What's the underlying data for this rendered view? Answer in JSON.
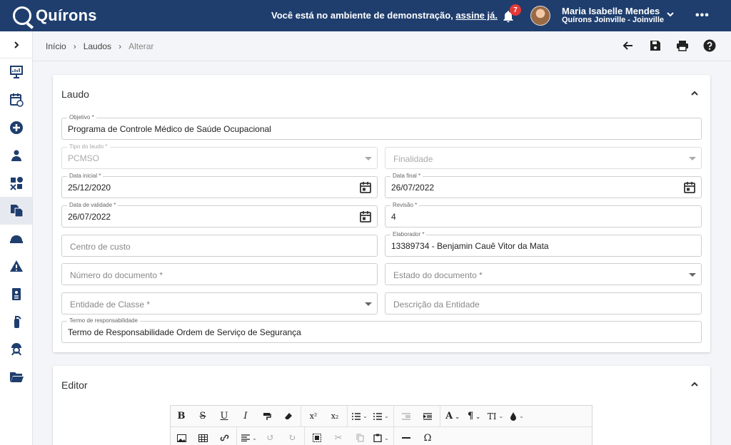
{
  "app": {
    "brand": "Quírons"
  },
  "header": {
    "demo_text": "Você está no ambiente de demonstração, ",
    "demo_link": "assine já.",
    "notifications": "7",
    "user_name": "Maria Isabelle Mendes",
    "user_org": "Quírons Joinville - Joinville"
  },
  "breadcrumb": {
    "home": "Início",
    "section": "Laudos",
    "current": "Alterar"
  },
  "card_laudo": {
    "title": "Laudo",
    "fields": {
      "objetivo": {
        "label": "Objetivo *",
        "value": "Programa de Controle Médico de Saúde Ocupacional"
      },
      "tipo": {
        "label": "Tipo do laudo *",
        "value": "PCMSO"
      },
      "finalidade": {
        "placeholder": "Finalidade"
      },
      "data_inicial": {
        "label": "Data inicial *",
        "value": "25/12/2020"
      },
      "data_final": {
        "label": "Data final *",
        "value": "26/07/2022"
      },
      "data_validade": {
        "label": "Data de validade *",
        "value": "26/07/2022"
      },
      "revisao": {
        "label": "Revisão *",
        "value": "4"
      },
      "centro_custo": {
        "placeholder": "Centro de custo"
      },
      "elaborador": {
        "label": "Elaborador *",
        "value": "13389734 - Benjamin Cauê Vitor da Mata"
      },
      "numero_doc": {
        "placeholder": "Número do documento *"
      },
      "estado_doc": {
        "placeholder": "Estado do documento *"
      },
      "entidade": {
        "placeholder": "Entidade de Classe *"
      },
      "desc_entidade": {
        "placeholder": "Descrição da Entidade"
      },
      "termo": {
        "label": "Termo de responsabilidade",
        "value": "Termo de Responsabilidade Ordem de Serviço de Segurança"
      }
    }
  },
  "card_editor": {
    "title": "Editor",
    "toolbar": {
      "bold": "B",
      "strike": "S",
      "underline": "U",
      "italic": "I",
      "superscript": "x²",
      "subscript": "x₂",
      "font_color": "A",
      "paragraph": "¶",
      "font_size": "TI",
      "special_char": "Ω"
    }
  },
  "colors": {
    "topbar": "#1f3e6e",
    "badge": "#e53935"
  }
}
